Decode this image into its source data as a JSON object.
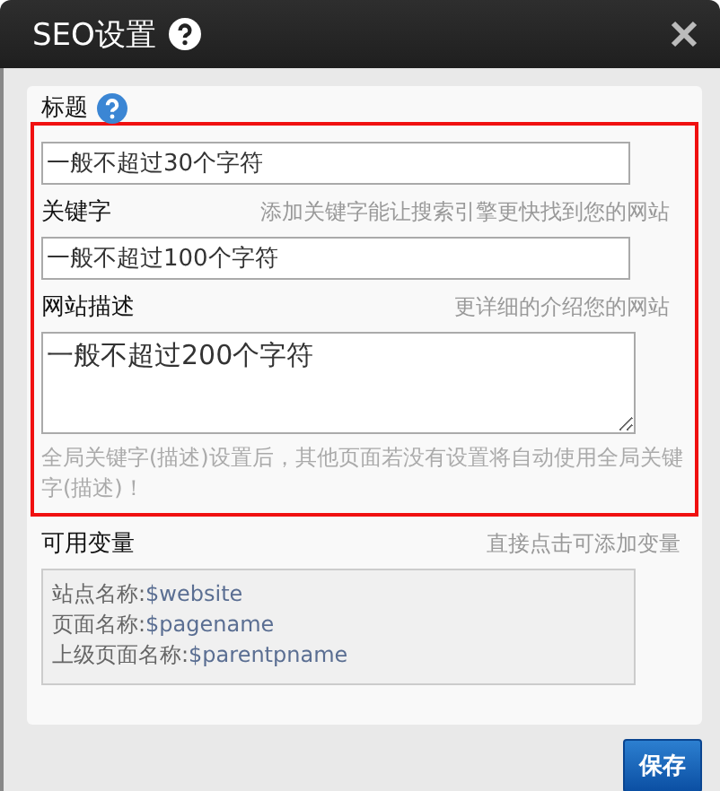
{
  "window": {
    "title": "SEO设置"
  },
  "title_field": {
    "label": "标题",
    "value": "一般不超过30个字符"
  },
  "keywords_field": {
    "label": "关键字",
    "hint": "添加关键字能让搜索引擎更快找到您的网站",
    "value": "一般不超过100个字符"
  },
  "description_field": {
    "label": "网站描述",
    "hint": "更详细的介绍您的网站",
    "value": "一般不超过200个字符"
  },
  "note": "全局关键字(描述)设置后，其他页面若没有设置将自动使用全局关键字(描述)！",
  "variables": {
    "label": "可用变量",
    "hint": "直接点击可添加变量",
    "items": [
      {
        "name": "站点名称:",
        "token": "$website"
      },
      {
        "name": "页面名称:",
        "token": "$pagename"
      },
      {
        "name": "上级页面名称:",
        "token": "$parentpname"
      }
    ]
  },
  "buttons": [
    "保存"
  ]
}
